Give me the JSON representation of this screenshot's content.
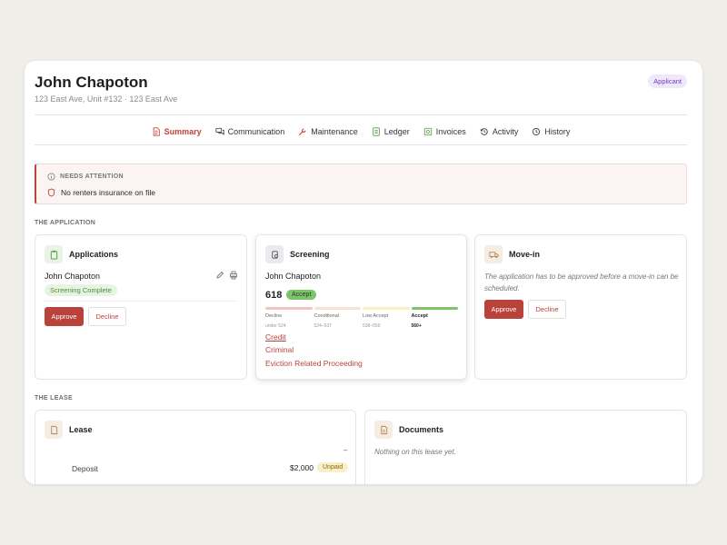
{
  "header": {
    "name": "John Chapoton",
    "address": "123 East Ave, Unit #132 · 123 East Ave",
    "role_badge": "Applicant"
  },
  "tabs": [
    {
      "label": "Summary",
      "icon": "document-icon",
      "active": true
    },
    {
      "label": "Communication",
      "icon": "chat-icon"
    },
    {
      "label": "Maintenance",
      "icon": "wrench-icon"
    },
    {
      "label": "Ledger",
      "icon": "ledger-icon"
    },
    {
      "label": "Invoices",
      "icon": "invoice-icon"
    },
    {
      "label": "Activity",
      "icon": "activity-icon"
    },
    {
      "label": "History",
      "icon": "history-icon"
    }
  ],
  "attention": {
    "title": "NEEDS ATTENTION",
    "message": "No renters insurance on file"
  },
  "application_section": {
    "heading": "THE APPLICATION",
    "applications": {
      "title": "Applications",
      "applicant": "John Chapoton",
      "status": "Screening Complete",
      "approve": "Approve",
      "decline": "Decline"
    },
    "screening": {
      "title": "Screening",
      "applicant": "John Chapoton",
      "score": "618",
      "result": "Accept",
      "bands": [
        {
          "label": "Decline",
          "range": "under 524",
          "color": "#f4c3c0"
        },
        {
          "label": "Conditional",
          "range": "524–537",
          "color": "#fbe1cf"
        },
        {
          "label": "Low Accept",
          "range": "538–559",
          "color": "#f7f1c2"
        },
        {
          "label": "Accept",
          "range": "560+",
          "color": "#7cc46c"
        }
      ],
      "links": [
        "Credit",
        "Criminal",
        "Eviction Related Proceeding"
      ]
    },
    "movein": {
      "title": "Move-in",
      "note": "The application has to be approved before a move-in can be scheduled.",
      "approve": "Approve",
      "decline": "Decline"
    }
  },
  "lease_section": {
    "heading": "THE LEASE",
    "lease": {
      "title": "Lease",
      "dash": "–",
      "deposit_label": "Deposit",
      "deposit_amount": "$2,000",
      "deposit_status": "Unpaid"
    },
    "documents": {
      "title": "Documents",
      "note": "Nothing on this lease yet."
    }
  },
  "colors": {
    "accent": "#c2413a",
    "approve": "#b9433a",
    "accept_green": "#7cc46c"
  }
}
